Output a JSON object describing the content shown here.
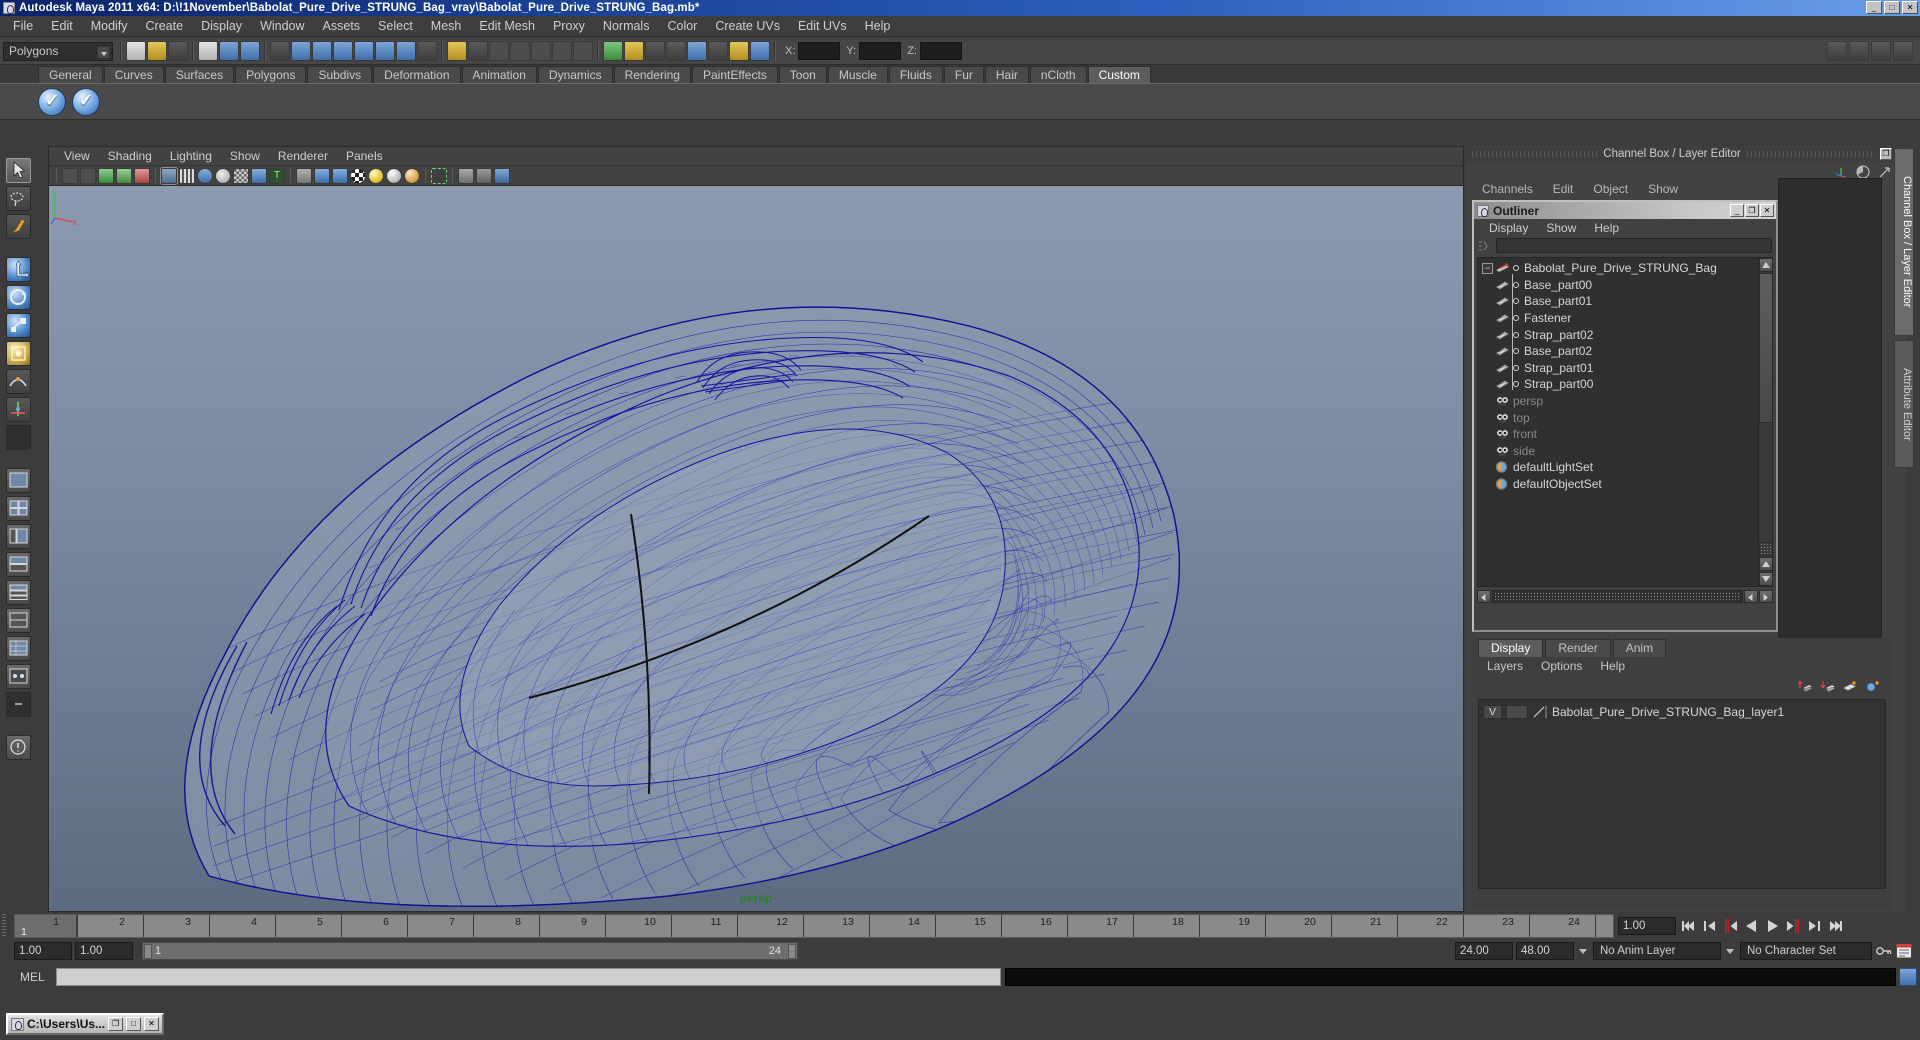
{
  "window": {
    "title": "Autodesk Maya 2011 x64: D:\\!1November\\Babolat_Pure_Drive_STRUNG_Bag_vray\\Babolat_Pure_Drive_STRUNG_Bag.mb*",
    "minimize": "_",
    "maximize": "□",
    "close": "✕"
  },
  "menubar": {
    "items": [
      "File",
      "Edit",
      "Modify",
      "Create",
      "Display",
      "Window",
      "Assets",
      "Select",
      "Mesh",
      "Edit Mesh",
      "Proxy",
      "Normals",
      "Color",
      "Create UVs",
      "Edit UVs",
      "Help"
    ]
  },
  "statusline": {
    "mode": "Polygons",
    "x_label": "X:",
    "y_label": "Y:",
    "z_label": "Z:",
    "x_value": "",
    "y_value": "",
    "z_value": ""
  },
  "shelf": {
    "tabs": [
      "General",
      "Curves",
      "Surfaces",
      "Polygons",
      "Subdivs",
      "Deformation",
      "Animation",
      "Dynamics",
      "Rendering",
      "PaintEffects",
      "Toon",
      "Muscle",
      "Fluids",
      "Fur",
      "Hair",
      "nCloth",
      "Custom"
    ],
    "active_tab": "Custom",
    "buttons": [
      "vray-render-icon",
      "vray-rt-render-icon"
    ]
  },
  "toolbox": {
    "tools": [
      "select-tool",
      "lasso-select-tool",
      "paint-select-tool",
      "move-tool",
      "rotate-tool",
      "scale-tool",
      "universal-manipulator-tool",
      "soft-modification-tool",
      "show-manipulator-tool",
      "last-tool-used",
      "single-perspective-view",
      "four-view-layout",
      "persp-outliner-layout",
      "persp-graph-layout",
      "persp-hypershade-layout",
      "two-pane-stacked-layout",
      "persp-uv-layout",
      "persp-relationship-layout",
      "view-arrangement-more"
    ]
  },
  "viewport": {
    "menu": [
      "View",
      "Shading",
      "Lighting",
      "Show",
      "Renderer",
      "Panels"
    ],
    "toolbar_icons": [
      "select-camera-icon",
      "camera-attributes-icon",
      "bookmark-icon",
      "image-plane-icon",
      "two-d-pan-zoom-icon",
      "wireframe-icon",
      "smooth-shade-all-icon",
      "shaded-icon",
      "wireframe-on-shaded-icon",
      "textured-icon",
      "use-all-lights-icon",
      "shadows-icon",
      "xray-icon",
      "no-gate-icon",
      "resolution-gate-icon",
      "film-gate-icon",
      "light-gate-icon",
      "default-light-icon",
      "all-lights-icon",
      "shadow-light-icon",
      "isolate-select-icon",
      "grid-toggle-icon",
      "film-gate-mask-icon",
      "ipr-render-icon"
    ],
    "camera_label": "persp",
    "axis": {
      "x": "x",
      "y": "y",
      "z": "z"
    }
  },
  "channel_box_panel": {
    "title": "Channel Box / Layer Editor",
    "restore": "❐",
    "close": "✕",
    "menu": [
      "Channels",
      "Edit",
      "Object",
      "Show"
    ],
    "icons": [
      "manipulator-icon",
      "channel-speed-icon",
      "channel-slider-icon"
    ]
  },
  "outliner": {
    "title": "Outliner",
    "window_buttons": {
      "minimize": "_",
      "maximize": "❐",
      "close": "✕"
    },
    "menu": [
      "Display",
      "Show",
      "Help"
    ],
    "search_value": "",
    "search_placeholder": "",
    "root": {
      "label": "Babolat_Pure_Drive_STRUNG_Bag",
      "expand_glyph": "−",
      "icon": "transform-group-icon"
    },
    "children": [
      {
        "label": "Base_part00",
        "icon": "mesh-icon"
      },
      {
        "label": "Base_part01",
        "icon": "mesh-icon"
      },
      {
        "label": "Fastener",
        "icon": "mesh-icon"
      },
      {
        "label": "Strap_part02",
        "icon": "mesh-icon"
      },
      {
        "label": "Base_part02",
        "icon": "mesh-icon"
      },
      {
        "label": "Strap_part01",
        "icon": "mesh-icon"
      },
      {
        "label": "Strap_part00",
        "icon": "mesh-icon"
      }
    ],
    "cameras": [
      {
        "label": "persp",
        "icon": "camera-icon"
      },
      {
        "label": "top",
        "icon": "camera-icon"
      },
      {
        "label": "front",
        "icon": "camera-icon"
      },
      {
        "label": "side",
        "icon": "camera-icon"
      }
    ],
    "sets": [
      {
        "label": "defaultLightSet",
        "icon": "set-icon"
      },
      {
        "label": "defaultObjectSet",
        "icon": "set-icon"
      }
    ]
  },
  "layer_editor": {
    "tabs": [
      "Display",
      "Render",
      "Anim"
    ],
    "active_tab": "Display",
    "menu": [
      "Layers",
      "Options",
      "Help"
    ],
    "tool_icons": [
      "layer-move-up-icon",
      "layer-move-down-icon",
      "new-layer-icon",
      "new-layer-from-selected-icon"
    ],
    "layers": [
      {
        "visibility": "V",
        "display_type": "",
        "name": "Babolat_Pure_Drive_STRUNG_Bag_layer1"
      }
    ]
  },
  "vertical_tabs": {
    "items": [
      "Channel Box / Layer Editor",
      "Attribute Editor"
    ],
    "active": "Channel Box / Layer Editor"
  },
  "timeline": {
    "ticks": [
      "1",
      "2",
      "3",
      "4",
      "5",
      "6",
      "7",
      "8",
      "9",
      "10",
      "11",
      "12",
      "13",
      "14",
      "15",
      "16",
      "17",
      "18",
      "19",
      "20",
      "21",
      "22",
      "23",
      "24"
    ],
    "current_frame": "1",
    "current_time_field": "1.00",
    "playback_buttons": [
      "go-to-start-icon",
      "step-back-keyframe-icon",
      "step-back-frame-icon",
      "play-backwards-icon",
      "play-forwards-icon",
      "step-forward-frame-icon",
      "step-forward-keyframe-icon",
      "go-to-end-icon"
    ]
  },
  "range_slider": {
    "anim_start": "1.00",
    "range_start": "1.00",
    "bar_start_label": "1",
    "bar_end_label": "24",
    "range_end": "24.00",
    "anim_end": "48.00",
    "anim_layer": "No Anim Layer",
    "character_set": "No Character Set",
    "auto_key_icon": "key-icon",
    "animation_prefs_icon": "animation-preferences-icon"
  },
  "command_line": {
    "label": "MEL",
    "input_value": "",
    "output_value": "",
    "script_editor_icon": "script-editor-icon"
  },
  "taskbar": {
    "window_title": "C:\\Users\\Us...",
    "buttons": {
      "restore": "❐",
      "maximize": "□",
      "close": "✕"
    }
  },
  "colors": {
    "title_blue": "#0a246a",
    "wireframe_blue": "#1414a0",
    "viewport_top": "#8b9ab0",
    "viewport_bottom": "#5d6b80",
    "persp_green": "#2f7d2f",
    "panel_gray": "#424242"
  }
}
